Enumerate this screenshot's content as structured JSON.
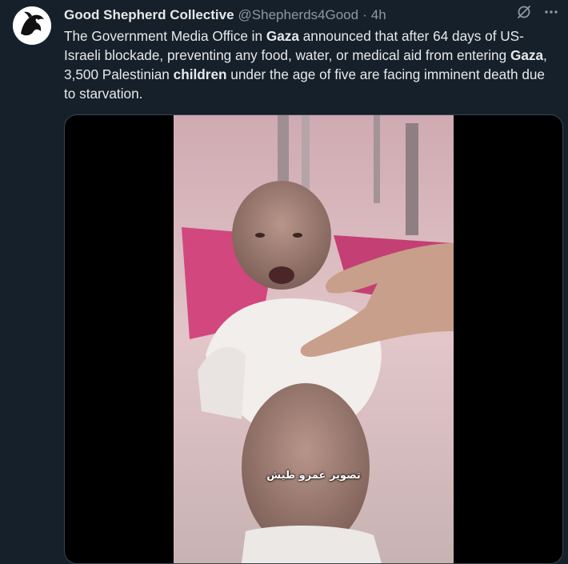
{
  "tweet": {
    "author_name": "Good Shepherd Collective",
    "handle": "@Shepherds4Good",
    "separator": "·",
    "time": "4h",
    "icons": [
      "grok-icon",
      "more-icon"
    ],
    "text_parts": [
      {
        "text": "The Government Media Office in ",
        "bold": false
      },
      {
        "text": "Gaza",
        "bold": true
      },
      {
        "text": " announced that after 64 days of US-Israeli blockade, preventing any food, water, or medical aid from entering ",
        "bold": false
      },
      {
        "text": "Gaza",
        "bold": true
      },
      {
        "text": ", 3,500 Palestinian ",
        "bold": false
      },
      {
        "text": "children",
        "bold": true
      },
      {
        "text": " under the age of five are facing imminent death due to starvation.",
        "bold": false
      }
    ]
  },
  "media": {
    "caption_overlay": "تصوير عمرو طيش"
  },
  "colors": {
    "background": "#15202b",
    "text": "#e7e9ea",
    "muted": "#8b98a5",
    "border": "#38444d"
  }
}
